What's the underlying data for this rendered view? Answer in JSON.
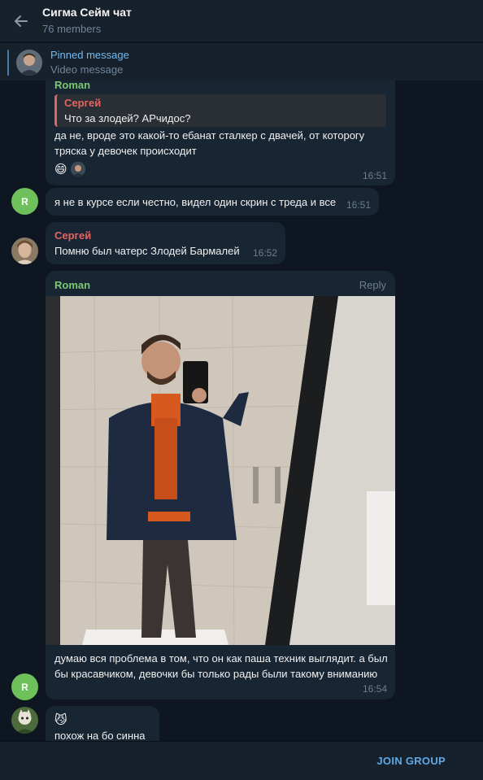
{
  "header": {
    "title": "Сигма Сейм чат",
    "members": "76 members"
  },
  "pinned": {
    "title": "Pinned message",
    "text": "Video message"
  },
  "messages": {
    "m1": {
      "sender": "Roman",
      "reply_sender": "Сергей",
      "reply_text": "Что за злодей? АРчидос?",
      "text": "да не, вроде это какой-то ебанат сталкер с двачей, от которогу тряска у девочек происходит",
      "reaction_1": "😄",
      "time": "16:51"
    },
    "m2": {
      "avatar_letter": "R",
      "text": "я не в курсе если честно, видел один скрин с треда и все",
      "time": "16:51"
    },
    "m3": {
      "sender": "Сергей",
      "text": "Помню был чатерс Злодей Бармалей",
      "time": "16:52"
    },
    "m4": {
      "sender": "Roman",
      "reply_label": "Reply",
      "text": "думаю вся проблема в том, что он как паша техник выглядит. а был бы красавчиком, девочки бы только рады были такому вниманию",
      "time": "16:54",
      "avatar_letter": "R"
    },
    "m5": {
      "emoji": "😼",
      "text": "похож на бо синна"
    }
  },
  "footer": {
    "join_label": "JOIN GROUP"
  },
  "colors": {
    "background": "#0e1621",
    "header": "#17212b",
    "bubble": "#182533",
    "accent": "#5fa8e4",
    "roman_name": "#7cc774",
    "sergey_name": "#e6645f"
  }
}
